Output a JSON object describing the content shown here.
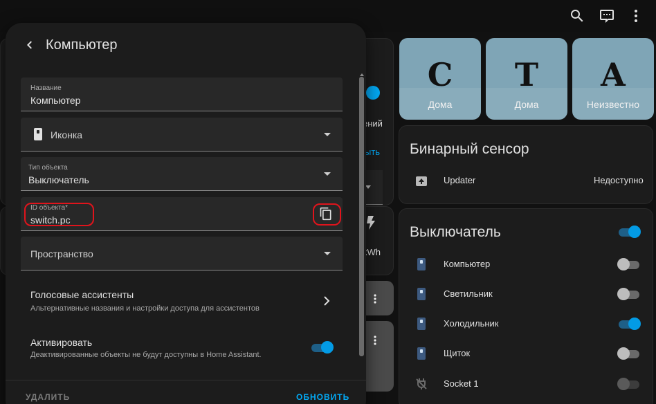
{
  "topbar": {
    "icons": [
      "search-icon",
      "chat-icon",
      "more-vert-icon"
    ]
  },
  "background": {
    "partial_texts": {
      "onoff": "ений",
      "link": "ыть",
      "energy": "kWh"
    }
  },
  "tiles": [
    {
      "letter": "С",
      "label": "Дома"
    },
    {
      "letter": "Т",
      "label": "Дома"
    },
    {
      "letter": "А",
      "label": "Неизвестно"
    }
  ],
  "binary_card": {
    "title": "Бинарный сенсор",
    "rows": [
      {
        "icon": "update-icon",
        "label": "Updater",
        "value": "Недоступно"
      }
    ]
  },
  "switch_card": {
    "title": "Выключатель",
    "master_on": true,
    "rows": [
      {
        "icon": "light-switch-icon",
        "label": "Компьютер",
        "on": false
      },
      {
        "icon": "light-switch-icon",
        "label": "Светильник",
        "on": false
      },
      {
        "icon": "light-switch-icon",
        "label": "Холодильник",
        "on": true
      },
      {
        "icon": "light-switch-icon",
        "label": "Щиток",
        "on": false
      },
      {
        "icon": "power-plug-off-icon",
        "label": "Socket 1",
        "on": false
      }
    ]
  },
  "dialog": {
    "title": "Компьютер",
    "name_field": {
      "label": "Название",
      "value": "Компьютер"
    },
    "icon_field": {
      "placeholder": "Иконка"
    },
    "type_field": {
      "label": "Тип объекта",
      "value": "Выключатель"
    },
    "id_field": {
      "label": "ID объекта*",
      "value": "switch.pc"
    },
    "area_field": {
      "placeholder": "Пространство"
    },
    "voice": {
      "title": "Голосовые ассистенты",
      "subtitle": "Альтернативные названия и настройки доступа для ассистентов"
    },
    "enable": {
      "title": "Активировать",
      "subtitle": "Деактивированные объекты не будут доступны в Home Assistant.",
      "on": true
    },
    "footer": {
      "delete_label": "УДАЛИТЬ",
      "update_label": "ОБНОВИТЬ"
    }
  },
  "colors": {
    "accent": "#03a9f4",
    "highlight": "#e0141c",
    "tile": "#7fa5b6"
  }
}
